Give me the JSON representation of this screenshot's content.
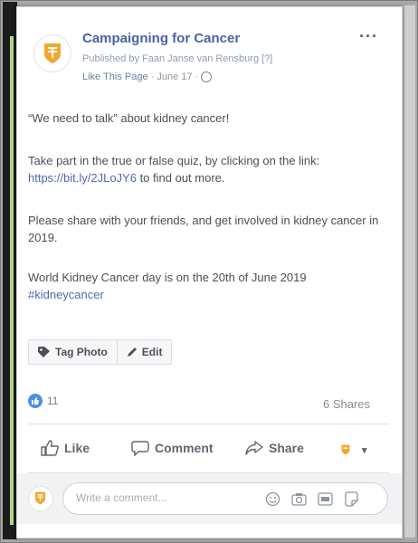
{
  "post": {
    "page_name": "Campaigning for Cancer",
    "published_by": "Published by Faan Janse van Rensburg [?]",
    "like_page": "Like This Page",
    "date_sep": " · ",
    "date": "June 17 ·",
    "more": "···",
    "paragraphs": {
      "p1": "“We need to talk” about kidney cancer!",
      "p2_a": "Take part in the true or false quiz, by clicking on the link: ",
      "p2_link": "https://bit.ly/2JLoJY6",
      "p2_b": " to find out more.",
      "p3": "Please share with your friends, and get involved in kidney cancer in 2019.",
      "p4_a": "World Kidney Cancer day is on the 20th of June 2019 ",
      "p4_tag": "#kidneycancer"
    }
  },
  "photo_actions": {
    "tag_photo": "Tag Photo",
    "edit": "Edit"
  },
  "stats": {
    "likes": "11",
    "shares": "6 Shares"
  },
  "actions": {
    "like": "Like",
    "comment": "Comment",
    "share": "Share",
    "page_dropdown": "▾"
  },
  "comment": {
    "placeholder": "Write a comment..."
  },
  "icons": [
    "more-icon",
    "globe-icon",
    "tag-icon",
    "pencil-icon",
    "thumbs-up-icon",
    "comment-icon",
    "share-icon",
    "emoji-icon",
    "camera-icon",
    "gif-icon",
    "sticker-icon"
  ],
  "colors": {
    "link": "#4c6bb0",
    "page_logo": "#f0a830",
    "like_badge": "#4d8fe6"
  }
}
